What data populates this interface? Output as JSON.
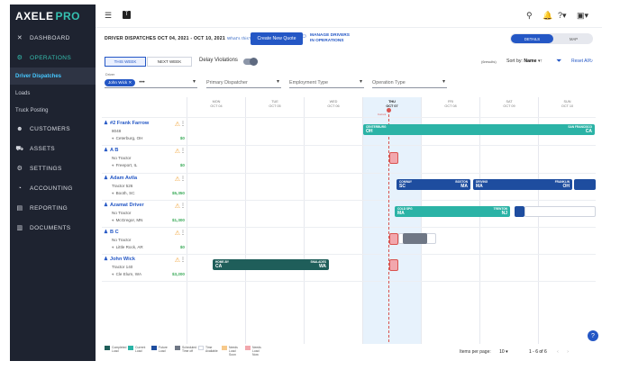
{
  "app": {
    "logo_main": "AXELE",
    "logo_pro": "PRO"
  },
  "sidebar": {
    "items": [
      {
        "label": "DASHBOARD",
        "icon": "dashboard-icon",
        "glyph": "✕"
      },
      {
        "label": "OPERATIONS",
        "icon": "operations-icon",
        "glyph": "⚙"
      },
      {
        "label": "CUSTOMERS",
        "icon": "customers-icon",
        "glyph": "☻"
      },
      {
        "label": "ASSETS",
        "icon": "assets-icon",
        "glyph": "⛟"
      },
      {
        "label": "SETTINGS",
        "icon": "settings-icon",
        "glyph": "⚙"
      },
      {
        "label": "ACCOUNTING",
        "icon": "accounting-icon",
        "glyph": "◔"
      },
      {
        "label": "REPORTING",
        "icon": "reporting-icon",
        "glyph": "▤"
      },
      {
        "label": "DOCUMENTS",
        "icon": "documents-icon",
        "glyph": "▥"
      }
    ],
    "sub_items": [
      "Driver Dispatches",
      "Loads",
      "Truck Posting"
    ]
  },
  "header": {
    "title": "DRIVER DISPATCHES OCT 04, 2021 - OCT 10, 2021",
    "whats_this": "What's this?",
    "new_quote": "Create New Quote",
    "manage_line1": "MANAGE DRIVERS",
    "manage_line2": "IN OPERATIONS",
    "view_details": "DETAILS",
    "view_map": "MAP"
  },
  "controls": {
    "this_week": "THIS WEEK",
    "next_week": "NEXT WEEK",
    "delay_violations": "Delay Violations",
    "results": "(6results)",
    "sort_label": "Sort by:",
    "sort_value": "Name",
    "reset": "Reset All"
  },
  "filters": {
    "driver_label": "Driver",
    "driver_chip": "John Wick",
    "primary_dispatcher": "Primary Dispatcher",
    "employment_type": "Employment Type",
    "operation_type": "Operation Type"
  },
  "days": [
    {
      "name": "MON",
      "date": "OCT 04"
    },
    {
      "name": "TUE",
      "date": "OCT 05"
    },
    {
      "name": "WED",
      "date": "OCT 06"
    },
    {
      "name": "THU",
      "date": "OCT 07"
    },
    {
      "name": "FRI",
      "date": "OCT 08"
    },
    {
      "name": "SAT",
      "date": "OCT 09"
    },
    {
      "name": "SUN",
      "date": "OCT 10"
    }
  ],
  "now_label": "Current",
  "drivers": [
    {
      "name": "#2 Frank Farrow",
      "line2": "8048",
      "location": "Ceterburg, OH",
      "amount": "$0"
    },
    {
      "name": "A B",
      "line2": "No Tractor",
      "location": "Freeport, IL",
      "amount": "$0"
    },
    {
      "name": "Adam Avila",
      "line2": "Tractor 526",
      "location": "Booth, SC",
      "amount": "$5,350"
    },
    {
      "name": "Azamat Driver",
      "line2": "No Tractor",
      "location": "McGregor, MN",
      "amount": "$1,300"
    },
    {
      "name": "B C",
      "line2": "No Tractor",
      "location": "Little Rock, AR",
      "amount": "$0"
    },
    {
      "name": "John Wick",
      "line2": "Tractor 140",
      "location": "Cle Elum, WA",
      "amount": "$3,200"
    }
  ],
  "loads": {
    "frank": {
      "from_small": "CENTERBURG",
      "from": "OH",
      "to_small": "SAN FRANCISCO",
      "to": "CA"
    },
    "adam1": {
      "from_small": "CONWAY",
      "from": "SC",
      "to_small": "BOSTON",
      "to": "MA"
    },
    "adam2": {
      "from_small": "DRIVING",
      "from": "MA",
      "to_small": "FRANKLIN",
      "to": "OH"
    },
    "azamat": {
      "from_small": "COLD SPG",
      "from": "MA",
      "to_small": "TRENTON",
      "to": "NJ"
    },
    "john": {
      "from_small": "HOME-BY",
      "from": "CA",
      "to_small": "SNALADES",
      "to": "WA"
    }
  },
  "legend": [
    {
      "label": "Completed Load",
      "color": "#1f5e5a"
    },
    {
      "label": "Current Load",
      "color": "#2bb3a6"
    },
    {
      "label": "Future Load",
      "color": "#1e4d9f"
    },
    {
      "label": "Scheduled Time off",
      "color": "#6f7785"
    },
    {
      "label": "Time Available",
      "color": "#ffffff"
    },
    {
      "label": "Needs Load Soon",
      "color": "#f7c98a"
    },
    {
      "label": "Needs Load Now",
      "color": "#f2a7ad"
    }
  ],
  "pager": {
    "label": "Items per page:",
    "per_page": "10",
    "range": "1 - 6 of 6"
  },
  "colors": {
    "sidebar": "#1e2330",
    "accent": "#2457c5",
    "teal": "#35c0b0"
  }
}
